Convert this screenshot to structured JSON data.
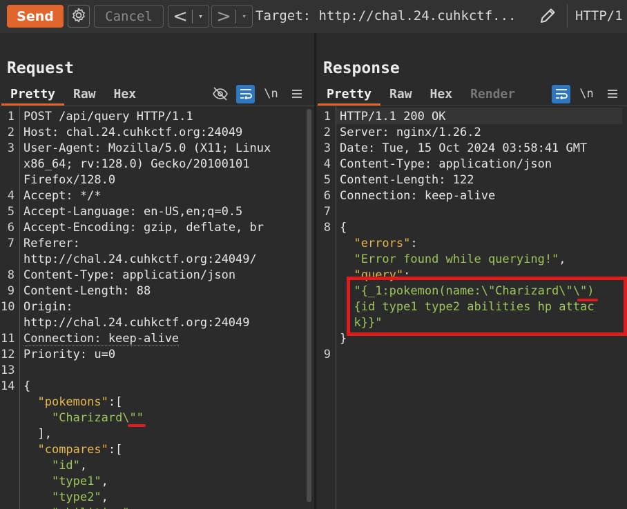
{
  "toolbar": {
    "send_label": "Send",
    "cancel_label": "Cancel",
    "back_label": "<",
    "forward_label": ">",
    "caret": "▾",
    "target_label": "Target: http://chal.24.cuhkctf...",
    "protocol_label": "HTTP/1"
  },
  "icons": {
    "settings": "gear-icon",
    "edit_target": "pencil-icon",
    "layout": [
      "split-columns-icon",
      "split-rows-icon",
      "tabs-icon"
    ],
    "hide": "eye-off-icon",
    "wrap": "wrap-lines-icon",
    "newline": "\\n",
    "menu": "hamburger-icon"
  },
  "colors": {
    "accent": "#e0662e",
    "active_tool": "#2f77c0",
    "json_key": "#e7b84a",
    "json_string": "#9cc65a",
    "annotation": "#e01b1b"
  },
  "request": {
    "title": "Request",
    "tabs": [
      "Pretty",
      "Raw",
      "Hex"
    ],
    "active_tab": "Pretty",
    "newline_label": "\\n",
    "lines": [
      {
        "n": "1",
        "segs": [
          [
            "k",
            "POST /api/query HTTP/1.1"
          ]
        ]
      },
      {
        "n": "2",
        "segs": [
          [
            "k",
            "Host: "
          ],
          [
            "v",
            "chal.24.cuhkctf.org:24049"
          ]
        ]
      },
      {
        "n": "3",
        "segs": [
          [
            "k",
            "User-Agent: "
          ],
          [
            "v",
            "Mozilla/5.0 (X11; Linux"
          ]
        ]
      },
      {
        "n": "",
        "segs": [
          [
            "v",
            "x86_64; rv:128.0) Gecko/20100101"
          ]
        ]
      },
      {
        "n": "",
        "segs": [
          [
            "v",
            "Firefox/128.0"
          ]
        ]
      },
      {
        "n": "4",
        "segs": [
          [
            "k",
            "Accept: "
          ],
          [
            "v",
            "*/*"
          ]
        ]
      },
      {
        "n": "5",
        "segs": [
          [
            "k",
            "Accept-Language: "
          ],
          [
            "v",
            "en-US,en;q=0.5"
          ]
        ]
      },
      {
        "n": "6",
        "segs": [
          [
            "k",
            "Accept-Encoding: "
          ],
          [
            "v",
            "gzip, deflate, br"
          ]
        ]
      },
      {
        "n": "7",
        "segs": [
          [
            "k",
            "Referer: "
          ]
        ]
      },
      {
        "n": "",
        "segs": [
          [
            "v",
            "http://chal.24.cuhkctf.org:24049/"
          ]
        ]
      },
      {
        "n": "8",
        "segs": [
          [
            "k",
            "Content-Type: "
          ],
          [
            "v",
            "application/json"
          ]
        ]
      },
      {
        "n": "9",
        "segs": [
          [
            "k",
            "Content-Length: "
          ],
          [
            "v",
            "88"
          ]
        ]
      },
      {
        "n": "10",
        "segs": [
          [
            "k",
            "Origin: "
          ]
        ]
      },
      {
        "n": "",
        "segs": [
          [
            "v",
            "http://chal.24.cuhkctf.org:24049"
          ]
        ]
      },
      {
        "n": "11",
        "segs": [
          [
            "dotted",
            "Connection: keep-alive"
          ]
        ]
      },
      {
        "n": "12",
        "segs": [
          [
            "k",
            "Priority: "
          ],
          [
            "v",
            "u=0"
          ]
        ]
      },
      {
        "n": "13",
        "segs": []
      },
      {
        "n": "14",
        "segs": [
          [
            "jp",
            "{"
          ]
        ]
      },
      {
        "n": "",
        "segs": [
          [
            "jp",
            "  "
          ],
          [
            "jk",
            "\"pokemons\""
          ],
          [
            "jp",
            ":["
          ]
        ]
      },
      {
        "n": "",
        "segs": [
          [
            "jp",
            "    "
          ],
          [
            "js",
            "\"Charizard\\\"\""
          ]
        ]
      },
      {
        "n": "",
        "segs": [
          [
            "jp",
            "  ],"
          ]
        ]
      },
      {
        "n": "",
        "segs": [
          [
            "jp",
            "  "
          ],
          [
            "jk",
            "\"compares\""
          ],
          [
            "jp",
            ":["
          ]
        ]
      },
      {
        "n": "",
        "segs": [
          [
            "jp",
            "    "
          ],
          [
            "js",
            "\"id\""
          ],
          [
            "jp",
            ","
          ]
        ]
      },
      {
        "n": "",
        "segs": [
          [
            "jp",
            "    "
          ],
          [
            "js",
            "\"type1\""
          ],
          [
            "jp",
            ","
          ]
        ]
      },
      {
        "n": "",
        "segs": [
          [
            "jp",
            "    "
          ],
          [
            "js",
            "\"type2\""
          ],
          [
            "jp",
            ","
          ]
        ]
      },
      {
        "n": "",
        "segs": [
          [
            "jp",
            "    "
          ],
          [
            "js",
            "\"abilities\""
          ]
        ]
      }
    ]
  },
  "response": {
    "title": "Response",
    "tabs": [
      "Pretty",
      "Raw",
      "Hex",
      "Render"
    ],
    "active_tab": "Pretty",
    "disabled_tab": "Render",
    "newline_label": "\\n",
    "lines": [
      {
        "n": "1",
        "segs": [
          [
            "k",
            "HTTP/1.1 200 OK"
          ]
        ]
      },
      {
        "n": "2",
        "segs": [
          [
            "k",
            "Server: "
          ],
          [
            "v",
            "nginx/1.26.2"
          ]
        ]
      },
      {
        "n": "3",
        "segs": [
          [
            "k",
            "Date: "
          ],
          [
            "v",
            "Tue, 15 Oct 2024 03:58:41 GMT"
          ]
        ]
      },
      {
        "n": "4",
        "segs": [
          [
            "k",
            "Content-Type: "
          ],
          [
            "v",
            "application/json"
          ]
        ]
      },
      {
        "n": "5",
        "segs": [
          [
            "k",
            "Content-Length: "
          ],
          [
            "v",
            "122"
          ]
        ]
      },
      {
        "n": "6",
        "segs": [
          [
            "k",
            "Connection: "
          ],
          [
            "v",
            "keep-alive"
          ]
        ]
      },
      {
        "n": "7",
        "segs": []
      },
      {
        "n": "8",
        "segs": [
          [
            "jp",
            "{"
          ]
        ]
      },
      {
        "n": "",
        "segs": [
          [
            "jp",
            "  "
          ],
          [
            "jk",
            "\"errors\""
          ],
          [
            "jp",
            ":"
          ]
        ]
      },
      {
        "n": "",
        "segs": [
          [
            "jp",
            "  "
          ],
          [
            "js",
            "\"Error found while querying!\""
          ],
          [
            "jp",
            ","
          ]
        ]
      },
      {
        "n": "",
        "segs": [
          [
            "jp",
            "  "
          ],
          [
            "jk",
            "\"query\""
          ],
          [
            "jp",
            ":"
          ]
        ]
      },
      {
        "n": "",
        "segs": [
          [
            "jp",
            "  "
          ],
          [
            "js",
            "\"{_1:pokemon(name:\\\"Charizard\\\"\\\")"
          ]
        ]
      },
      {
        "n": "",
        "segs": [
          [
            "jp",
            "  "
          ],
          [
            "js",
            "{id type1 type2 abilities hp attac"
          ]
        ]
      },
      {
        "n": "",
        "segs": [
          [
            "jp",
            "  "
          ],
          [
            "js",
            "k}}\""
          ]
        ]
      },
      {
        "n": "",
        "segs": [
          [
            "jp",
            "}"
          ]
        ]
      },
      {
        "n": "9",
        "segs": []
      }
    ]
  }
}
